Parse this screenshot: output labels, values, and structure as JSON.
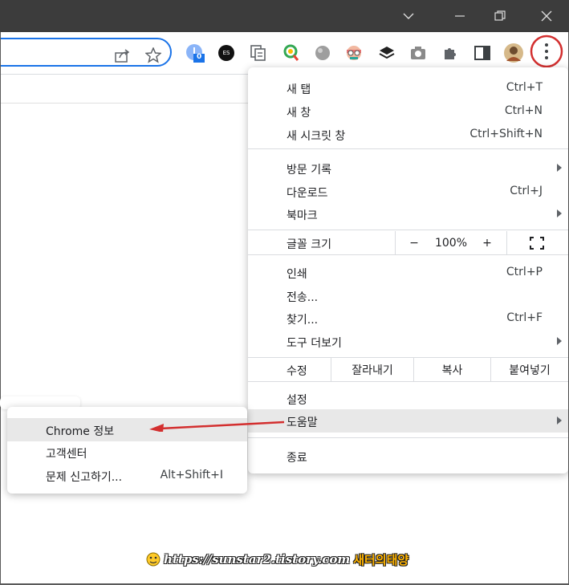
{
  "toolbar": {
    "extensions": [
      "download-badge-icon",
      "es-extension-icon",
      "tab-copy-icon",
      "color-picker-icon",
      "globe-extension-icon",
      "face-extension-icon",
      "layers-extension-icon",
      "camera-icon",
      "puzzle-icon",
      "side-panel-icon",
      "profile-avatar",
      "more-menu-icon"
    ],
    "download_badge": "0",
    "es_label": "ES"
  },
  "menu": {
    "new_tab": {
      "label": "새 탭",
      "shortcut": "Ctrl+T"
    },
    "new_window": {
      "label": "새 창",
      "shortcut": "Ctrl+N"
    },
    "incognito": {
      "label": "새 시크릿 창",
      "shortcut": "Ctrl+Shift+N"
    },
    "history": {
      "label": "방문 기록"
    },
    "downloads": {
      "label": "다운로드",
      "shortcut": "Ctrl+J"
    },
    "bookmarks": {
      "label": "북마크"
    },
    "zoom": {
      "label": "글꼴 크기",
      "minus": "−",
      "value": "100%",
      "plus": "+"
    },
    "print": {
      "label": "인쇄",
      "shortcut": "Ctrl+P"
    },
    "cast": {
      "label": "전송..."
    },
    "find": {
      "label": "찾기...",
      "shortcut": "Ctrl+F"
    },
    "more_tools": {
      "label": "도구 더보기"
    },
    "edit": {
      "label": "수정",
      "cut": "잘라내기",
      "copy": "복사",
      "paste": "붙여넣기"
    },
    "settings": {
      "label": "설정"
    },
    "help": {
      "label": "도움말"
    },
    "exit": {
      "label": "종료"
    }
  },
  "help_submenu": {
    "about": {
      "label": "Chrome 정보"
    },
    "help_center": {
      "label": "고객센터"
    },
    "report": {
      "label": "문제 신고하기...",
      "shortcut": "Alt+Shift+I"
    }
  },
  "watermark": {
    "url": "https://sunstar2.tistory.com",
    "name": "새터의태양"
  },
  "colors": {
    "accent": "#1a73e8",
    "highlight": "#e8e8e8",
    "annotation": "#d32f2f",
    "titlebar": "#3c3c3c"
  }
}
